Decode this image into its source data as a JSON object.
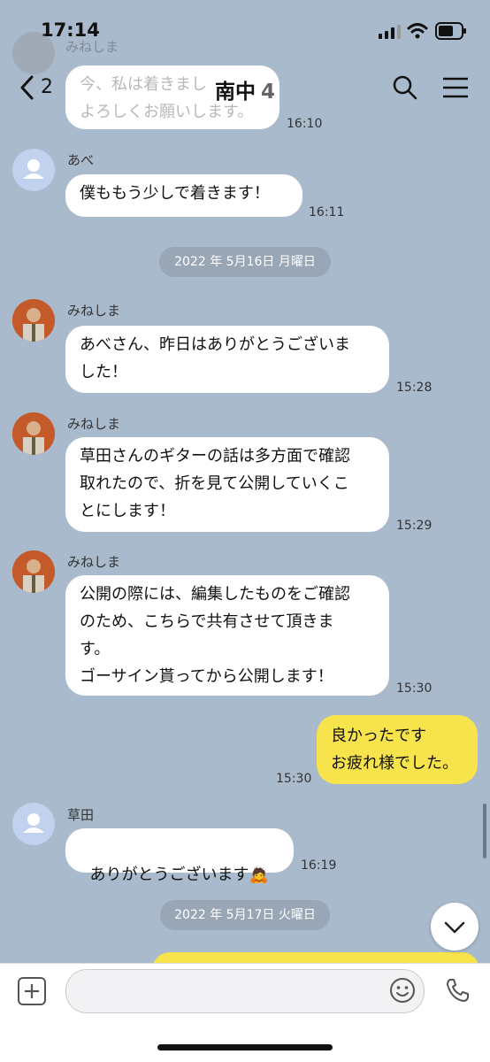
{
  "status": {
    "time": "17:14"
  },
  "header": {
    "back_count": "2",
    "title": "南中",
    "member_count": "4"
  },
  "messages": [
    {
      "sender": "みねしま",
      "text": "今、私は着きまし\nよろしくお願いします。",
      "time": "16:10"
    },
    {
      "sender": "あべ",
      "text": "僕ももう少しで着きます！",
      "time": "16:11"
    },
    {
      "date": "2022 年 5月16日 月曜日"
    },
    {
      "sender": "みねしま",
      "text": "あべさん、昨日はありがとうございま\nした！",
      "time": "15:28"
    },
    {
      "sender": "みねしま",
      "text": "草田さんのギターの話は多方面で確認\n取れたので、折を見て公開していくこ\nとにします！",
      "time": "15:29"
    },
    {
      "sender": "みねしま",
      "text": "公開の際には、編集したものをご確認\nのため、こちらで共有させて頂きま\nす。\nゴーサイン貰ってから公開します！",
      "time": "15:30"
    },
    {
      "sender": "me",
      "text": "良かったです\nお疲れ様でした。",
      "time": "15:30"
    },
    {
      "sender": "草田",
      "text": "ありがとうございます",
      "emoji": "🙇",
      "time": "16:19"
    },
    {
      "date": "2022 年 5月17日 火曜日"
    }
  ],
  "colors": {
    "background": "#a9bacc",
    "mine_bubble": "#f7e34c",
    "other_bubble": "#ffffff"
  },
  "icons": [
    "back-chevron-icon",
    "search-icon",
    "menu-icon",
    "plus-icon",
    "emoji-icon",
    "phone-icon",
    "scroll-down-icon",
    "signal-icon",
    "wifi-icon",
    "battery-icon"
  ]
}
